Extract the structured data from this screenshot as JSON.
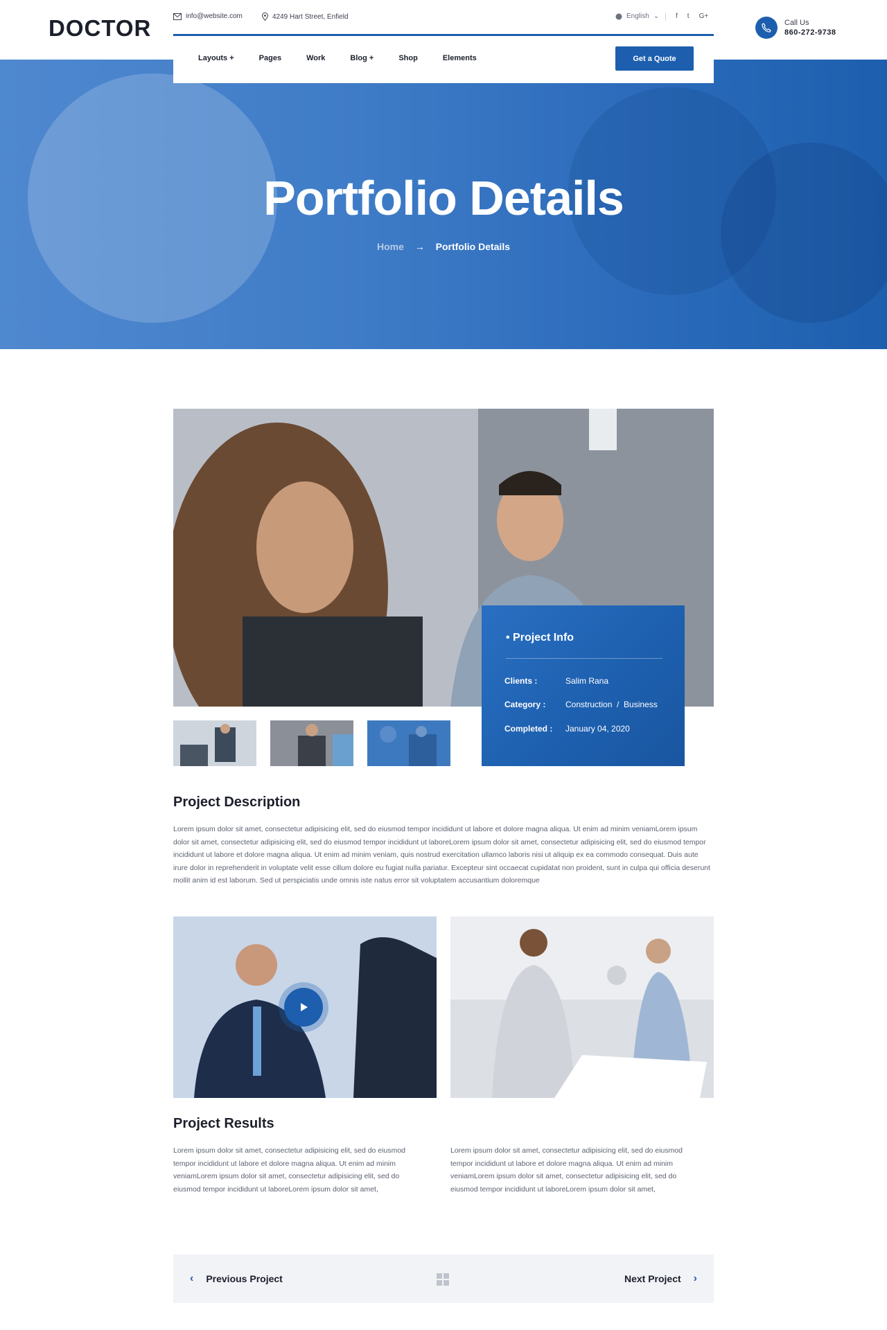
{
  "brand": {
    "logo": "DOCTOR"
  },
  "topbar": {
    "email": "info@website.com",
    "address": "4249 Hart Street, Enfield",
    "language": "English",
    "social": [
      "f",
      "t",
      "G+"
    ]
  },
  "call": {
    "label": "Call Us",
    "number": "860-272-9738"
  },
  "nav": {
    "items": [
      "Layouts +",
      "Pages",
      "Work",
      "Blog +",
      "Shop",
      "Elements"
    ],
    "cta": "Get a Quote"
  },
  "hero": {
    "title": "Portfolio Details",
    "breadcrumb_home": "Home",
    "breadcrumb_current": "Portfolio Details"
  },
  "project_info": {
    "title": "Project Info",
    "rows": [
      {
        "key": "Clients :",
        "value": "Salim Rana"
      },
      {
        "key": "Category :",
        "value": "Construction  /  Business"
      },
      {
        "key": "Completed :",
        "value": "January 04, 2020"
      }
    ]
  },
  "description": {
    "heading": "Project Description",
    "text": "Lorem ipsum dolor sit amet, consectetur adipisicing elit, sed do eiusmod tempor incididunt ut labore et dolore magna aliqua. Ut enim ad minim veniamLorem ipsum dolor sit amet, consectetur adipisicing elit, sed do eiusmod tempor incididunt ut laboreLorem ipsum dolor sit amet, consectetur adipisicing elit, sed do eiusmod tempor incididunt ut labore et dolore magna aliqua. Ut enim ad minim veniam, quis nostrud exercitation ullamco laboris nisi ut aliquip ex ea commodo consequat. Duis aute irure dolor in reprehenderit in voluptate velit esse cillum dolore eu fugiat nulla pariatur. Excepteur sint occaecat cupidatat non proident, sunt in culpa qui officia deserunt mollit anim id est laborum. Sed ut perspiciatis unde omnis iste natus error sit voluptatem accusantium doloremque"
  },
  "results": {
    "heading": "Project Results",
    "col1": "Lorem ipsum dolor sit amet, consectetur adipisicing elit, sed do eiusmod tempor incididunt ut labore et dolore magna aliqua. Ut enim ad minim veniamLorem ipsum dolor sit amet, consectetur adipisicing elit, sed do eiusmod tempor incididunt ut laboreLorem ipsum dolor sit amet,",
    "col2": "Lorem ipsum dolor sit amet, consectetur adipisicing elit, sed do eiusmod tempor incididunt ut labore et dolore magna aliqua. Ut enim ad minim veniamLorem ipsum dolor sit amet, consectetur adipisicing elit, sed do eiusmod tempor incididunt ut laboreLorem ipsum dolor sit amet,"
  },
  "pager": {
    "prev": "Previous Project",
    "next": "Next Project"
  },
  "colors": {
    "primary": "#1d5fae",
    "text": "#1b1f2b",
    "muted": "#5b6170",
    "pager_bg": "#f1f3f7"
  }
}
